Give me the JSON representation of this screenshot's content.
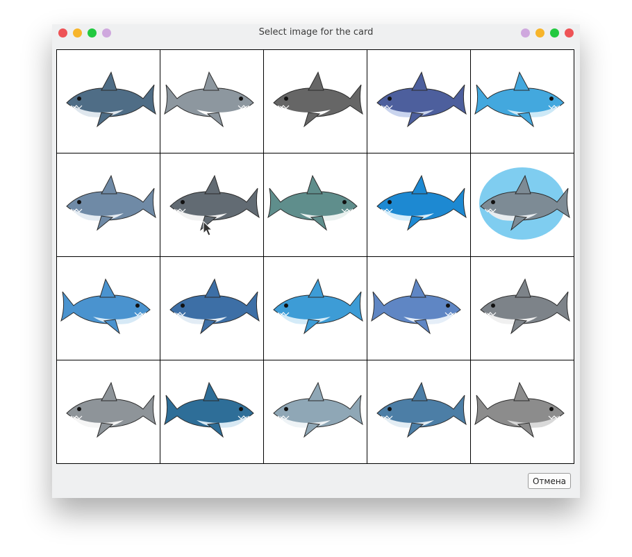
{
  "window": {
    "title": "Select image for the card",
    "controls_left": [
      {
        "name": "close",
        "color": "#ee5356"
      },
      {
        "name": "minimize",
        "color": "#f7b52b"
      },
      {
        "name": "maximize",
        "color": "#22c940"
      },
      {
        "name": "extra",
        "color": "#cfa8de"
      }
    ],
    "controls_right": [
      {
        "name": "extra",
        "color": "#cfa8de"
      },
      {
        "name": "minimize",
        "color": "#f7b52b"
      },
      {
        "name": "maximize",
        "color": "#22c940"
      },
      {
        "name": "close",
        "color": "#ee5356"
      }
    ]
  },
  "images": [
    {
      "icon": "shark-image",
      "body": "#4f6d86",
      "belly": "#dfe7ee",
      "bg": "#ffffff"
    },
    {
      "icon": "shark-image",
      "body": "#8d979f",
      "belly": "#ffffff",
      "bg": "#ffffff"
    },
    {
      "icon": "shark-image",
      "body": "#666666",
      "belly": "#ffffff",
      "bg": "#ffffff"
    },
    {
      "icon": "shark-image",
      "body": "#4d5f9d",
      "belly": "#c9d4ee",
      "bg": "#ffffff"
    },
    {
      "icon": "shark-image",
      "body": "#43a8de",
      "belly": "#cde9f7",
      "bg": "#ffffff"
    },
    {
      "icon": "shark-image",
      "body": "#6f8aa6",
      "belly": "#e5ecf3",
      "bg": "#ffffff"
    },
    {
      "icon": "shark-image",
      "body": "#626b73",
      "belly": "#f2f2f2",
      "bg": "#ffffff"
    },
    {
      "icon": "shark-image",
      "body": "#5f8e8c",
      "belly": "#e9f1ef",
      "bg": "#ffffff"
    },
    {
      "icon": "shark-image",
      "body": "#1d89d2",
      "belly": "#d7eefb",
      "bg": "#ffffff"
    },
    {
      "icon": "shark-image",
      "body": "#7d8b95",
      "belly": "#e8edf0",
      "bg": "#7fcdf0"
    },
    {
      "icon": "shark-image",
      "body": "#4a93cf",
      "belly": "#d6e9f6",
      "bg": "#ffffff"
    },
    {
      "icon": "shark-image",
      "body": "#3d6fa6",
      "belly": "#e2ecf5",
      "bg": "#ffffff"
    },
    {
      "icon": "shark-image",
      "body": "#3d9cd6",
      "belly": "#d4ebf8",
      "bg": "#ffffff"
    },
    {
      "icon": "shark-image",
      "body": "#5f86c4",
      "belly": "#e5eef8",
      "bg": "#ffffff"
    },
    {
      "icon": "shark-image",
      "body": "#7d8389",
      "belly": "#f0f0f0",
      "bg": "#ffffff"
    },
    {
      "icon": "shark-image",
      "body": "#8e9499",
      "belly": "#f5f5f5",
      "bg": "#ffffff"
    },
    {
      "icon": "shark-image",
      "body": "#2e6e98",
      "belly": "#d7e8f3",
      "bg": "#ffffff"
    },
    {
      "icon": "shark-image",
      "body": "#8fa7b6",
      "belly": "#eef3f6",
      "bg": "#ffffff"
    },
    {
      "icon": "shark-image",
      "body": "#4c7ea6",
      "belly": "#e3edf4",
      "bg": "#ffffff"
    },
    {
      "icon": "shark-image",
      "body": "#8c8c8c",
      "belly": "#d9d9d9",
      "bg": "#ffffff"
    }
  ],
  "buttons": {
    "cancel": "Отмена"
  }
}
